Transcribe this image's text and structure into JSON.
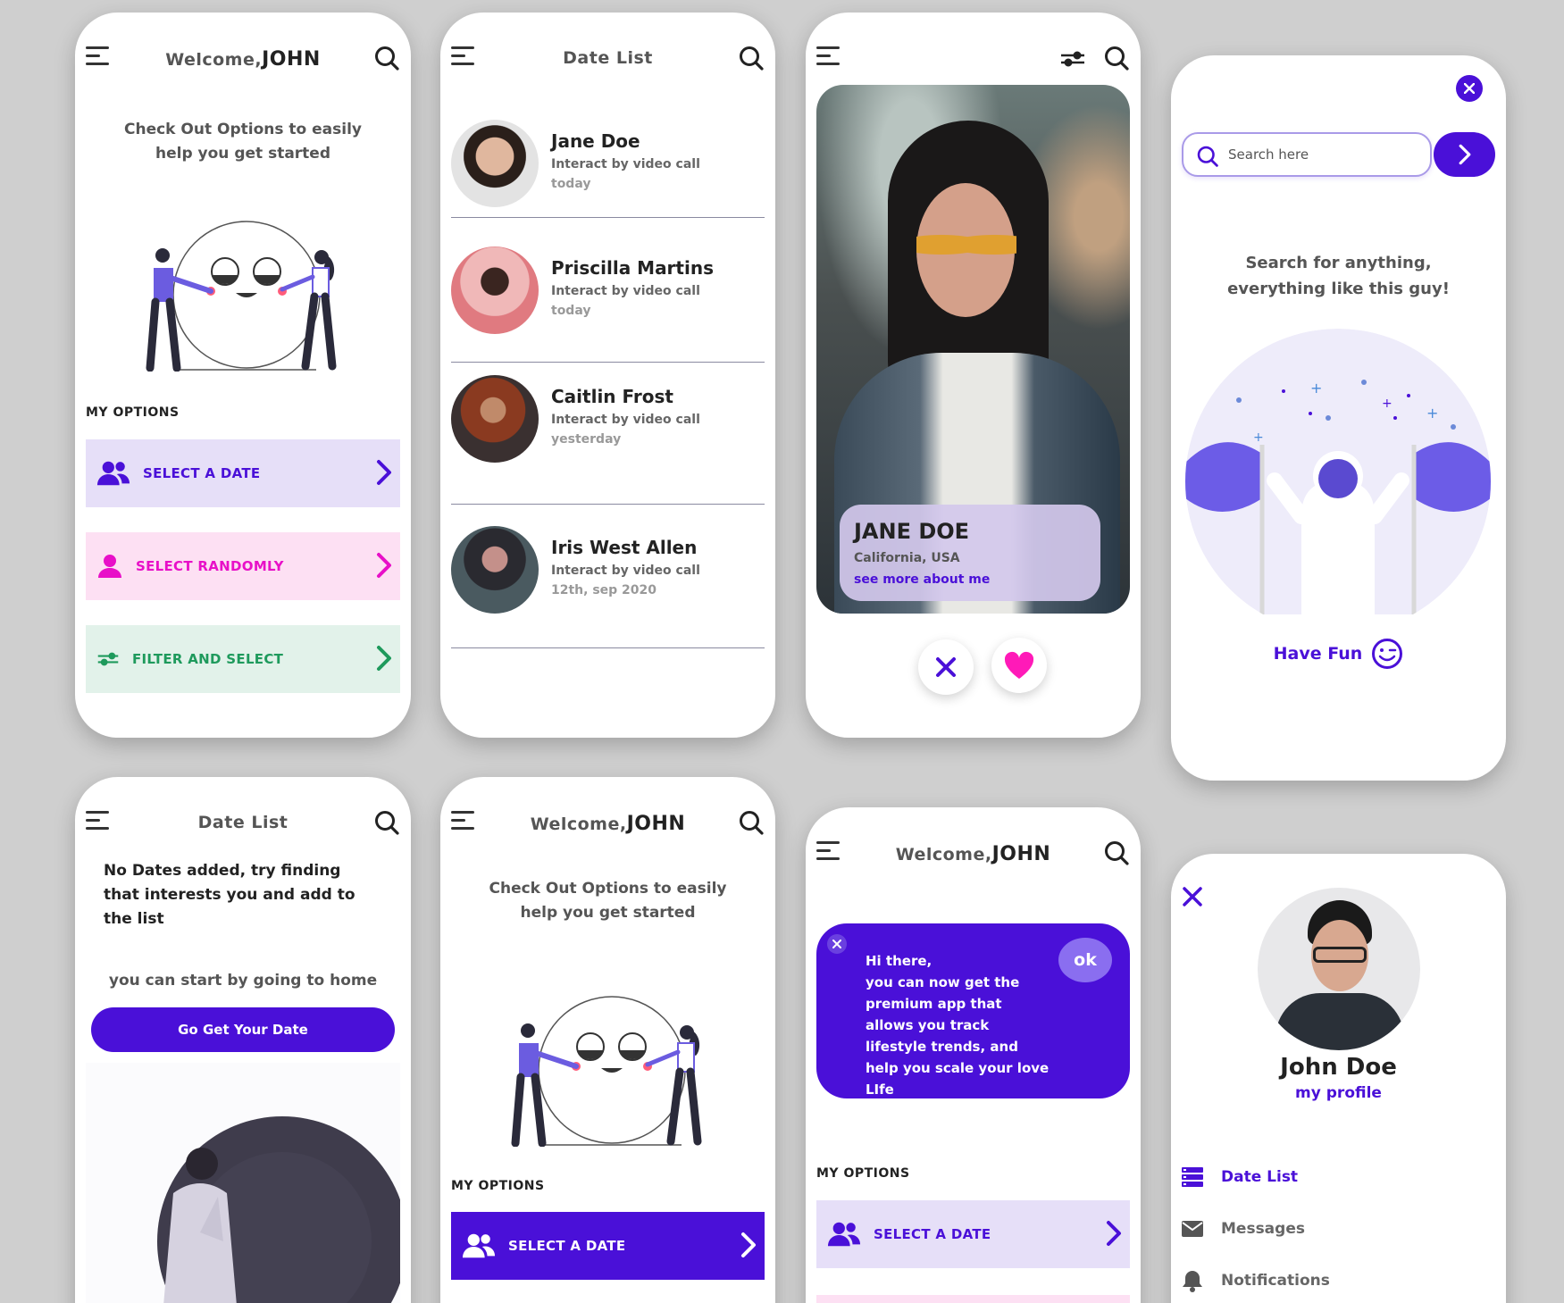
{
  "colors": {
    "accent": "#4a10d8",
    "purple_light": "#e6dff8",
    "pink": "#e810c8",
    "pink_light": "#fde0f3",
    "green": "#1e9a5c",
    "green_light": "#e2f2ea",
    "heart": "#ff1ab8"
  },
  "welcome": {
    "prefix": "Welcome,",
    "name": "JOHN"
  },
  "home": {
    "intro": "Check Out Options to easily help you get started",
    "options_label": "MY OPTIONS",
    "options": [
      {
        "label": "SELECT A DATE",
        "icon": "users-icon"
      },
      {
        "label": "SELECT RANDOMLY",
        "icon": "user-icon"
      },
      {
        "label": "FILTER AND SELECT",
        "icon": "filter-icon"
      }
    ]
  },
  "date_list": {
    "title": "Date List",
    "items": [
      {
        "name": "Jane Doe",
        "sub": "Interact by video call",
        "time": "today"
      },
      {
        "name": "Priscilla Martins",
        "sub": "Interact by video call",
        "time": "today"
      },
      {
        "name": "Caitlin Frost",
        "sub": "Interact by video call",
        "time": "yesterday"
      },
      {
        "name": "Iris West Allen",
        "sub": "Interact by video call",
        "time": "12th, sep 2020"
      }
    ]
  },
  "profile_card": {
    "name": "JANE DOE",
    "location": "California, USA",
    "link": "see more about me"
  },
  "search": {
    "placeholder": "Search here",
    "message": "Search for anything, everything like this guy!",
    "footer": "Have Fun"
  },
  "empty_list": {
    "title": "Date List",
    "message": "No Dates added, try finding that interests you and add to the list",
    "hint": "you can start by going to home",
    "button": "Go Get Your Date"
  },
  "premium": {
    "message": "Hi there,\nyou can now get the premium app that allows you track lifestyle trends, and help you scale your love LIfe",
    "ok": "ok"
  },
  "menu": {
    "name": "John Doe",
    "profile_link": "my profile",
    "items": [
      {
        "label": "Date List",
        "icon": "list-icon",
        "active": true
      },
      {
        "label": "Messages",
        "icon": "mail-icon",
        "active": false
      },
      {
        "label": "Notifications",
        "icon": "bell-icon",
        "active": false
      }
    ]
  }
}
